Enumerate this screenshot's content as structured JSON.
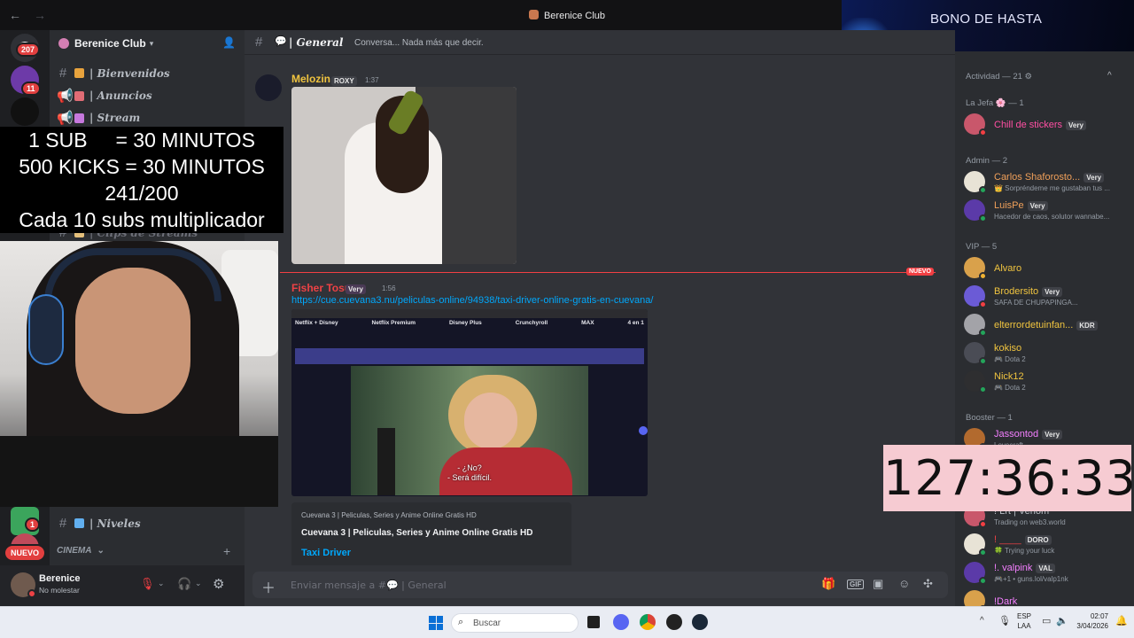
{
  "window": {
    "title": "Berenice Club"
  },
  "banner": {
    "text": "BONO DE HASTA"
  },
  "rail": {
    "mentions_badge": "207",
    "dm_badge": "11",
    "dm2_badge": "1",
    "new_label": "NUEVO"
  },
  "server": {
    "name": "Berenice Club"
  },
  "channels": [
    {
      "icon": "hash",
      "name": "| Bienvenidos",
      "emoji_color": "#e8a33d"
    },
    {
      "icon": "megaphone",
      "name": "| Anuncios",
      "emoji_color": "#e06c75"
    },
    {
      "icon": "megaphone",
      "name": "| Stream",
      "emoji_color": "#c678dd"
    },
    {
      "icon": "hash",
      "name": "| Clips de Streams",
      "emoji_color": "#e5c07b"
    },
    {
      "icon": "hash",
      "name": "| Niveles",
      "emoji_color": "#61afef"
    }
  ],
  "category": {
    "name": "CINEMA"
  },
  "user": {
    "name": "Berenice",
    "status": "No molestar"
  },
  "chat_header": {
    "channel": "General",
    "topic": "Conversa... Nada más que decir."
  },
  "messages": [
    {
      "author": "Melozin",
      "author_color": "#f0c43f",
      "tag": "ROXY",
      "time": "1:37"
    },
    {
      "author": "Fisher Tosu",
      "author_color": "#ed4245",
      "tag": "Very",
      "time": "1:56",
      "link": "https://cue.cuevana3.nu/peliculas-online/94938/taxi-driver-online-gratis-en-cuevana/",
      "embed_site": "Cuevana 3 | Peliculas, Series y Anime Online Gratis HD",
      "embed_title": "Cuevana 3 | Peliculas, Series y Anime Online Gratis HD",
      "embed_link": "Taxi Driver",
      "video_tabs": [
        "Netflix + Disney",
        "Netflix Premium",
        "Disney Plus",
        "Crunchyroll",
        "MAX",
        "4 en 1"
      ],
      "subtitle_line1": "- ¿No?",
      "subtitle_line2": "- Será difícil."
    }
  ],
  "new_divider": "NUEVO",
  "input": {
    "placeholder": "Enviar mensaje a #💬 | General"
  },
  "members": {
    "activity_header": "Actividad — 21",
    "groups": [
      {
        "title": "La Jefa 🌸 — 1",
        "items": [
          {
            "name": "Chill de stickers",
            "color": "#ff4fa3",
            "tag": "Very",
            "sub": ""
          }
        ]
      },
      {
        "title": "Admin — 2",
        "items": [
          {
            "name": "Carlos Shaforosto...",
            "color": "#f0a05a",
            "tag": "Very",
            "sub": "👑 Sorpréndeme me gustaban tus ..."
          },
          {
            "name": "LuisPe",
            "color": "#f0a05a",
            "tag": "Very",
            "sub": "Hacedor de caos, solutor wannabe..."
          }
        ]
      },
      {
        "title": "VIP — 5",
        "items": [
          {
            "name": "Alvaro",
            "color": "#f0c43f",
            "tag": "",
            "sub": ""
          },
          {
            "name": "Brodersito",
            "color": "#f0c43f",
            "tag": "Very",
            "sub": "SAFA DE CHUPAPINGA..."
          },
          {
            "name": "elterrordetuinfan...",
            "color": "#f0c43f",
            "tag": "KDR",
            "sub": ""
          },
          {
            "name": "kokiso",
            "color": "#f0c43f",
            "tag": "",
            "sub": "🎮 Dota 2"
          },
          {
            "name": "Nick12",
            "color": "#f0c43f",
            "tag": "",
            "sub": "🎮 Dota 2"
          }
        ]
      },
      {
        "title": "Booster — 1",
        "items": [
          {
            "name": "Jassontod",
            "color": "#f47fff",
            "tag": "Very",
            "sub": "Lovecraft"
          }
        ]
      }
    ],
    "lower": [
      {
        "name": "! Lrt | Venom",
        "color": "#b5bac1",
        "tag": "",
        "sub": "Trading on web3.world"
      },
      {
        "name": "! ____",
        "color": "#ed4245",
        "tag": "DORO",
        "sub": "🍀 Trying your luck"
      },
      {
        "name": "!. valpink",
        "color": "#f47fff",
        "tag": "VAL",
        "sub": "🎮+1 • guns.lol/valp1nk"
      },
      {
        "name": "!Dark",
        "color": "#f47fff",
        "tag": "",
        "sub": ""
      }
    ]
  },
  "overlay": {
    "lines": [
      "1 SUB     = 30 MINUTOS",
      "500 KICKS = 30 MINUTOS",
      "241/200",
      "Cada 10 subs multiplicador"
    ],
    "timer": "127:36:33"
  },
  "taskbar": {
    "search": "Buscar",
    "lang1": "ESP",
    "lang2": "LAA",
    "time": "02:07",
    "date": "3/04/2026"
  }
}
